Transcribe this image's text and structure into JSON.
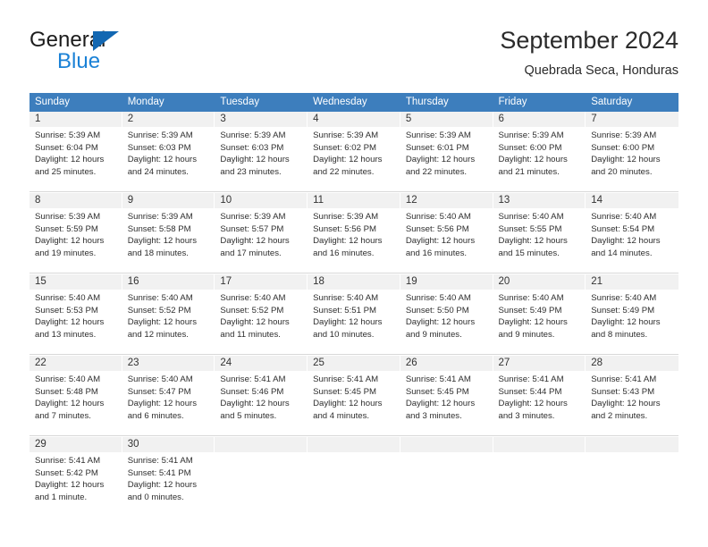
{
  "brand": {
    "name_top": "General",
    "name_bottom": "Blue",
    "triangle_color": "#1267b2",
    "blue_color": "#1a81d6"
  },
  "header": {
    "title": "September 2024",
    "subtitle": "Quebrada Seca, Honduras"
  },
  "theme": {
    "header_bg": "#3d7ebd",
    "daynum_bg": "#f1f1f1",
    "text": "#2e2e2e"
  },
  "weekdays": [
    "Sunday",
    "Monday",
    "Tuesday",
    "Wednesday",
    "Thursday",
    "Friday",
    "Saturday"
  ],
  "weeks": [
    [
      {
        "day": "1",
        "sunrise": "Sunrise: 5:39 AM",
        "sunset": "Sunset: 6:04 PM",
        "daylight1": "Daylight: 12 hours",
        "daylight2": "and 25 minutes."
      },
      {
        "day": "2",
        "sunrise": "Sunrise: 5:39 AM",
        "sunset": "Sunset: 6:03 PM",
        "daylight1": "Daylight: 12 hours",
        "daylight2": "and 24 minutes."
      },
      {
        "day": "3",
        "sunrise": "Sunrise: 5:39 AM",
        "sunset": "Sunset: 6:03 PM",
        "daylight1": "Daylight: 12 hours",
        "daylight2": "and 23 minutes."
      },
      {
        "day": "4",
        "sunrise": "Sunrise: 5:39 AM",
        "sunset": "Sunset: 6:02 PM",
        "daylight1": "Daylight: 12 hours",
        "daylight2": "and 22 minutes."
      },
      {
        "day": "5",
        "sunrise": "Sunrise: 5:39 AM",
        "sunset": "Sunset: 6:01 PM",
        "daylight1": "Daylight: 12 hours",
        "daylight2": "and 22 minutes."
      },
      {
        "day": "6",
        "sunrise": "Sunrise: 5:39 AM",
        "sunset": "Sunset: 6:00 PM",
        "daylight1": "Daylight: 12 hours",
        "daylight2": "and 21 minutes."
      },
      {
        "day": "7",
        "sunrise": "Sunrise: 5:39 AM",
        "sunset": "Sunset: 6:00 PM",
        "daylight1": "Daylight: 12 hours",
        "daylight2": "and 20 minutes."
      }
    ],
    [
      {
        "day": "8",
        "sunrise": "Sunrise: 5:39 AM",
        "sunset": "Sunset: 5:59 PM",
        "daylight1": "Daylight: 12 hours",
        "daylight2": "and 19 minutes."
      },
      {
        "day": "9",
        "sunrise": "Sunrise: 5:39 AM",
        "sunset": "Sunset: 5:58 PM",
        "daylight1": "Daylight: 12 hours",
        "daylight2": "and 18 minutes."
      },
      {
        "day": "10",
        "sunrise": "Sunrise: 5:39 AM",
        "sunset": "Sunset: 5:57 PM",
        "daylight1": "Daylight: 12 hours",
        "daylight2": "and 17 minutes."
      },
      {
        "day": "11",
        "sunrise": "Sunrise: 5:39 AM",
        "sunset": "Sunset: 5:56 PM",
        "daylight1": "Daylight: 12 hours",
        "daylight2": "and 16 minutes."
      },
      {
        "day": "12",
        "sunrise": "Sunrise: 5:40 AM",
        "sunset": "Sunset: 5:56 PM",
        "daylight1": "Daylight: 12 hours",
        "daylight2": "and 16 minutes."
      },
      {
        "day": "13",
        "sunrise": "Sunrise: 5:40 AM",
        "sunset": "Sunset: 5:55 PM",
        "daylight1": "Daylight: 12 hours",
        "daylight2": "and 15 minutes."
      },
      {
        "day": "14",
        "sunrise": "Sunrise: 5:40 AM",
        "sunset": "Sunset: 5:54 PM",
        "daylight1": "Daylight: 12 hours",
        "daylight2": "and 14 minutes."
      }
    ],
    [
      {
        "day": "15",
        "sunrise": "Sunrise: 5:40 AM",
        "sunset": "Sunset: 5:53 PM",
        "daylight1": "Daylight: 12 hours",
        "daylight2": "and 13 minutes."
      },
      {
        "day": "16",
        "sunrise": "Sunrise: 5:40 AM",
        "sunset": "Sunset: 5:52 PM",
        "daylight1": "Daylight: 12 hours",
        "daylight2": "and 12 minutes."
      },
      {
        "day": "17",
        "sunrise": "Sunrise: 5:40 AM",
        "sunset": "Sunset: 5:52 PM",
        "daylight1": "Daylight: 12 hours",
        "daylight2": "and 11 minutes."
      },
      {
        "day": "18",
        "sunrise": "Sunrise: 5:40 AM",
        "sunset": "Sunset: 5:51 PM",
        "daylight1": "Daylight: 12 hours",
        "daylight2": "and 10 minutes."
      },
      {
        "day": "19",
        "sunrise": "Sunrise: 5:40 AM",
        "sunset": "Sunset: 5:50 PM",
        "daylight1": "Daylight: 12 hours",
        "daylight2": "and 9 minutes."
      },
      {
        "day": "20",
        "sunrise": "Sunrise: 5:40 AM",
        "sunset": "Sunset: 5:49 PM",
        "daylight1": "Daylight: 12 hours",
        "daylight2": "and 9 minutes."
      },
      {
        "day": "21",
        "sunrise": "Sunrise: 5:40 AM",
        "sunset": "Sunset: 5:49 PM",
        "daylight1": "Daylight: 12 hours",
        "daylight2": "and 8 minutes."
      }
    ],
    [
      {
        "day": "22",
        "sunrise": "Sunrise: 5:40 AM",
        "sunset": "Sunset: 5:48 PM",
        "daylight1": "Daylight: 12 hours",
        "daylight2": "and 7 minutes."
      },
      {
        "day": "23",
        "sunrise": "Sunrise: 5:40 AM",
        "sunset": "Sunset: 5:47 PM",
        "daylight1": "Daylight: 12 hours",
        "daylight2": "and 6 minutes."
      },
      {
        "day": "24",
        "sunrise": "Sunrise: 5:41 AM",
        "sunset": "Sunset: 5:46 PM",
        "daylight1": "Daylight: 12 hours",
        "daylight2": "and 5 minutes."
      },
      {
        "day": "25",
        "sunrise": "Sunrise: 5:41 AM",
        "sunset": "Sunset: 5:45 PM",
        "daylight1": "Daylight: 12 hours",
        "daylight2": "and 4 minutes."
      },
      {
        "day": "26",
        "sunrise": "Sunrise: 5:41 AM",
        "sunset": "Sunset: 5:45 PM",
        "daylight1": "Daylight: 12 hours",
        "daylight2": "and 3 minutes."
      },
      {
        "day": "27",
        "sunrise": "Sunrise: 5:41 AM",
        "sunset": "Sunset: 5:44 PM",
        "daylight1": "Daylight: 12 hours",
        "daylight2": "and 3 minutes."
      },
      {
        "day": "28",
        "sunrise": "Sunrise: 5:41 AM",
        "sunset": "Sunset: 5:43 PM",
        "daylight1": "Daylight: 12 hours",
        "daylight2": "and 2 minutes."
      }
    ],
    [
      {
        "day": "29",
        "sunrise": "Sunrise: 5:41 AM",
        "sunset": "Sunset: 5:42 PM",
        "daylight1": "Daylight: 12 hours",
        "daylight2": "and 1 minute."
      },
      {
        "day": "30",
        "sunrise": "Sunrise: 5:41 AM",
        "sunset": "Sunset: 5:41 PM",
        "daylight1": "Daylight: 12 hours",
        "daylight2": "and 0 minutes."
      },
      {
        "day": "",
        "sunrise": "",
        "sunset": "",
        "daylight1": "",
        "daylight2": ""
      },
      {
        "day": "",
        "sunrise": "",
        "sunset": "",
        "daylight1": "",
        "daylight2": ""
      },
      {
        "day": "",
        "sunrise": "",
        "sunset": "",
        "daylight1": "",
        "daylight2": ""
      },
      {
        "day": "",
        "sunrise": "",
        "sunset": "",
        "daylight1": "",
        "daylight2": ""
      },
      {
        "day": "",
        "sunrise": "",
        "sunset": "",
        "daylight1": "",
        "daylight2": ""
      }
    ]
  ]
}
